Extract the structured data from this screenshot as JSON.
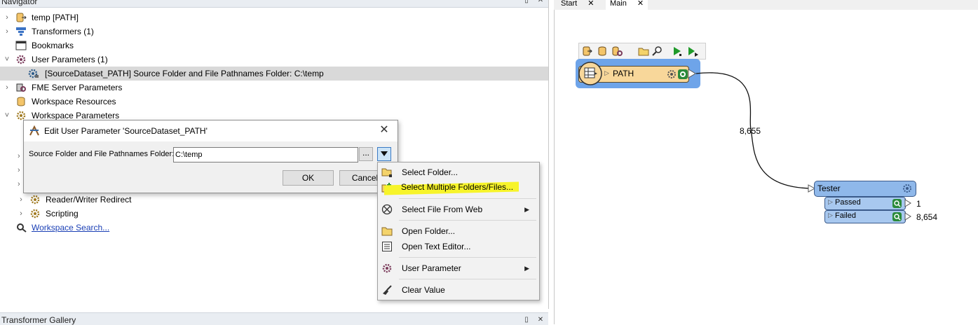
{
  "navigator": {
    "title": "Navigator",
    "items": [
      {
        "label": "temp [PATH]",
        "chevron": "›"
      },
      {
        "label": "Transformers (1)",
        "chevron": "›"
      },
      {
        "label": "Bookmarks",
        "chevron": ""
      },
      {
        "label": "User Parameters (1)",
        "chevron": "˅"
      },
      {
        "label": "[SourceDataset_PATH] Source Folder and File Pathnames Folder: C:\\temp",
        "chevron": ""
      },
      {
        "label": "FME Server Parameters",
        "chevron": "›"
      },
      {
        "label": "Workspace Resources",
        "chevron": ""
      },
      {
        "label": "Workspace Parameters",
        "chevron": "˅"
      },
      {
        "label": "Reader/Writer Redirect",
        "chevron": "›"
      },
      {
        "label": "Scripting",
        "chevron": "›"
      },
      {
        "label": "Workspace Search...",
        "chevron": ""
      }
    ]
  },
  "gallery": {
    "title": "Transformer Gallery"
  },
  "canvas_tabs": [
    {
      "label": "Start"
    },
    {
      "label": "Main"
    }
  ],
  "dialog": {
    "title": "Edit User Parameter  'SourceDataset_PATH'",
    "field_label": "Source Folder and File Pathnames Folder:",
    "field_value": "C:\\temp",
    "browse_label": "...",
    "ok_label": "OK",
    "cancel_label": "Cancel"
  },
  "menu": {
    "items": [
      {
        "label": "Select Folder...",
        "icon": "folder-select-icon",
        "submenu": false
      },
      {
        "label": "Select Multiple Folders/Files...",
        "icon": "folder-multi-icon",
        "submenu": false,
        "highlighted": true
      },
      {
        "label": "Select File From Web",
        "icon": "web-icon",
        "submenu": true
      },
      {
        "label": "Open Folder...",
        "icon": "folder-icon",
        "submenu": false
      },
      {
        "label": "Open Text Editor...",
        "icon": "text-editor-icon",
        "submenu": false
      },
      {
        "label": "User Parameter",
        "icon": "gear-icon",
        "submenu": true
      },
      {
        "label": "Clear Value",
        "icon": "broom-icon",
        "submenu": false
      }
    ]
  },
  "workflow": {
    "reader": {
      "label": "PATH"
    },
    "connection_count": "8,655",
    "tester": {
      "label": "Tester"
    },
    "ports": [
      {
        "label": "Passed",
        "count": "1"
      },
      {
        "label": "Failed",
        "count": "8,654"
      }
    ]
  },
  "colors": {
    "highlight": "#f7f42a",
    "reader_fill": "#f8d79a",
    "reader_selected_bg": "#6ea4e9",
    "tester_fill": "#8fb8ea",
    "link": "#1a3fb5"
  }
}
